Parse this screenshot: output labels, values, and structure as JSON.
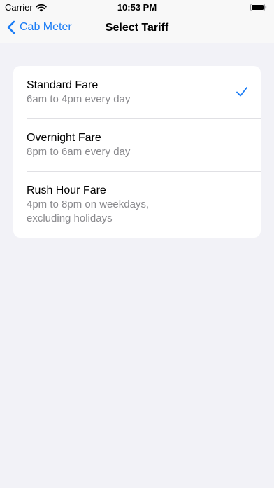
{
  "status_bar": {
    "carrier": "Carrier",
    "time": "10:53 PM"
  },
  "nav": {
    "back_label": "Cab Meter",
    "title": "Select Tariff"
  },
  "tariffs": [
    {
      "title": "Standard Fare",
      "subtitle_lines": [
        "6am to 4pm every day"
      ],
      "selected": true
    },
    {
      "title": "Overnight Fare",
      "subtitle_lines": [
        "8pm to 6am every day"
      ],
      "selected": false
    },
    {
      "title": "Rush Hour Fare",
      "subtitle_lines": [
        "4pm to 8pm on weekdays,",
        "excluding holidays"
      ],
      "selected": false
    }
  ],
  "colors": {
    "accent": "#1a7cf5",
    "background": "#f2f2f7",
    "secondary_text": "#8a8a8e"
  },
  "icons": {
    "back": "chevron-left-icon",
    "selected": "checkmark-icon",
    "wifi": "wifi-icon",
    "battery": "battery-icon"
  }
}
